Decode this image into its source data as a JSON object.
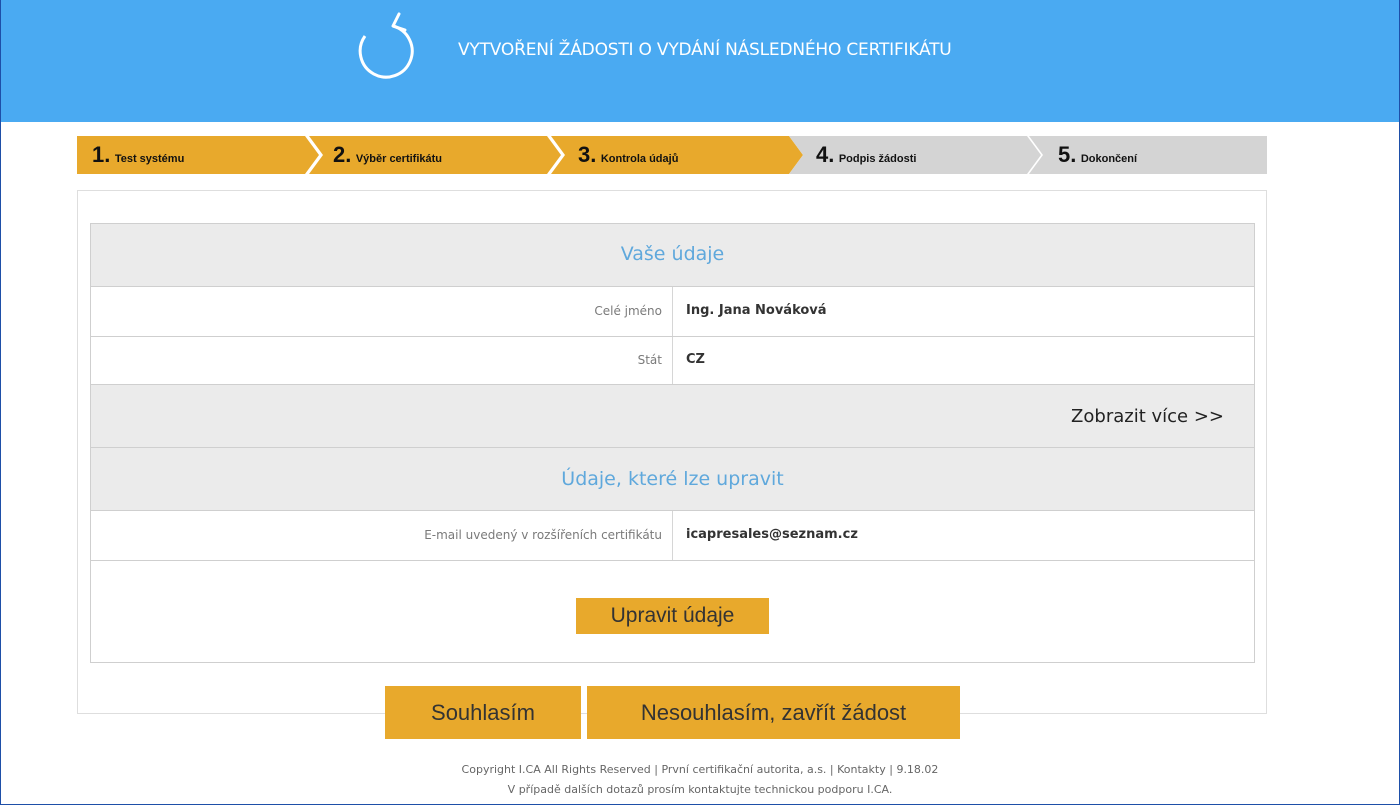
{
  "header": {
    "title": "VYTVOŘENÍ ŽÁDOSTI O VYDÁNÍ NÁSLEDNÉHO CERTIFIKÁTU",
    "logo_icon": "refresh-arrow-icon",
    "background": "#4aaaf2"
  },
  "steps": [
    {
      "num": "1.",
      "label": "Test systému",
      "state": "done"
    },
    {
      "num": "2.",
      "label": "Výběr certifikátu",
      "state": "done"
    },
    {
      "num": "3.",
      "label": "Kontrola údajů",
      "state": "active"
    },
    {
      "num": "4.",
      "label": "Podpis žádosti",
      "state": "pending"
    },
    {
      "num": "5.",
      "label": "Dokončení",
      "state": "pending"
    }
  ],
  "colors": {
    "step_done": "#e8a92c",
    "step_pending": "#d4d4d4",
    "accent_text": "#5fa8dc",
    "button": "#e8a92c"
  },
  "your_data": {
    "heading": "Vaše údaje",
    "fields": [
      {
        "label": "Celé jméno",
        "value": "Ing. Jana Nováková"
      },
      {
        "label": "Stát",
        "value": "CZ"
      }
    ],
    "show_more": "Zobrazit více >>"
  },
  "editable": {
    "heading": "Údaje, které lze upravit",
    "fields": [
      {
        "label": "E-mail uvedený v rozšířeních certifikátu",
        "value": "icapresales@seznam.cz"
      }
    ],
    "edit_button": "Upravit údaje"
  },
  "actions": {
    "agree": "Souhlasím",
    "disagree": "Nesouhlasím, zavřít žádost"
  },
  "footer": {
    "line1": "Copyright I.CA All Rights Reserved | První certifikační autorita, a.s. | Kontakty | 9.18.02",
    "line2": "V případě dalších dotazů prosím kontaktujte technickou podporu I.CA."
  }
}
